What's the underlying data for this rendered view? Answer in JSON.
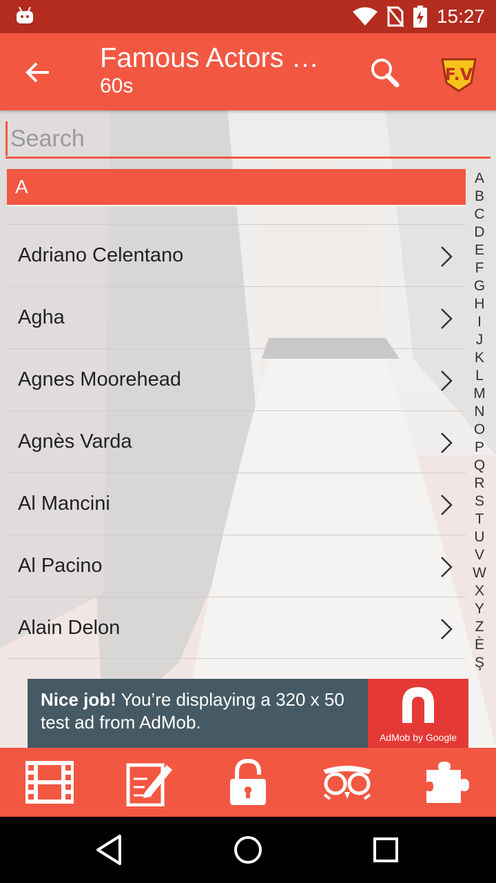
{
  "status_bar": {
    "time": "15:27",
    "icons": [
      "android-icon",
      "wifi-icon",
      "no-sim-icon",
      "battery-charging-icon"
    ]
  },
  "app_bar": {
    "title": "Famous Actors a…",
    "subtitle": "60s",
    "back_icon": "arrow-left-icon",
    "search_icon": "magnifier-icon",
    "logo_text": "F.V"
  },
  "search": {
    "placeholder": "Search",
    "value": ""
  },
  "section_header": "A",
  "items": [
    {
      "name": "Adriano Celentano"
    },
    {
      "name": "Agha"
    },
    {
      "name": "Agnes Moorehead"
    },
    {
      "name": "Agnès Varda"
    },
    {
      "name": "Al Mancini"
    },
    {
      "name": "Al Pacino"
    },
    {
      "name": "Alain Delon"
    }
  ],
  "alphabet": [
    "A",
    "B",
    "C",
    "D",
    "E",
    "F",
    "G",
    "H",
    "I",
    "J",
    "K",
    "L",
    "M",
    "N",
    "O",
    "P",
    "Q",
    "R",
    "S",
    "T",
    "U",
    "V",
    "W",
    "X",
    "Y",
    "Z",
    "È",
    "Ş"
  ],
  "ad": {
    "headline": "Nice job!",
    "body": " You’re displaying a 320 x 50 test ad from AdMob.",
    "brand_caption": "AdMob by Google"
  },
  "toolbar": {
    "items": [
      "film-icon",
      "edit-note-icon",
      "unlock-icon",
      "owl-icon",
      "puzzle-icon"
    ]
  },
  "navbar": {
    "items": [
      "back-triangle-icon",
      "home-circle-icon",
      "recents-square-icon"
    ]
  },
  "colors": {
    "accent": "#f25742",
    "status_bar": "#b32c1f",
    "ad_bg": "#455a64",
    "ad_brand": "#e53935"
  }
}
